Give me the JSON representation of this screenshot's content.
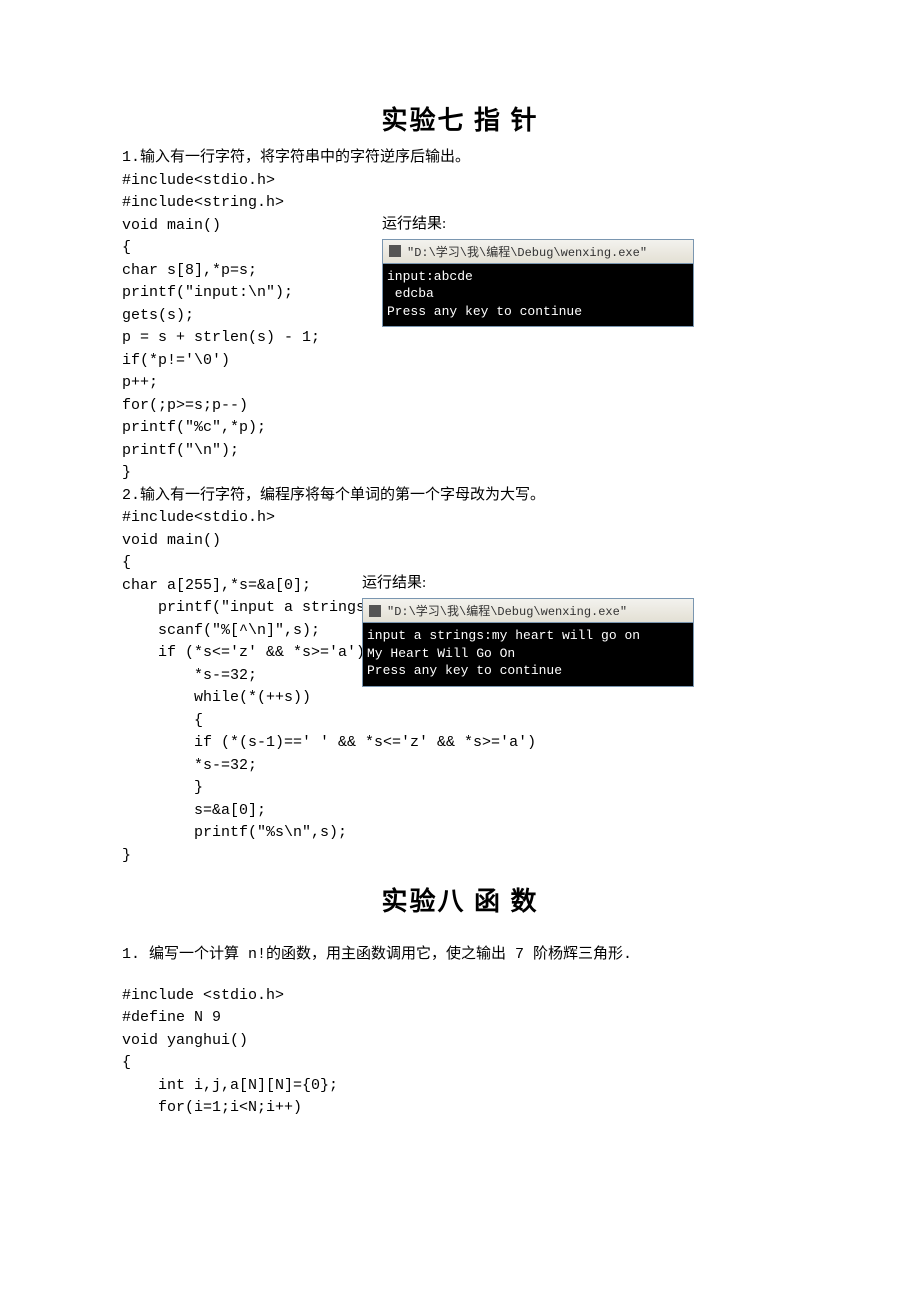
{
  "section7": {
    "title": "实验七  指  针",
    "problem1": {
      "desc": "1.输入有一行字符，将字符串中的字符逆序后输出。",
      "code_a": "#include<stdio.h>\n#include<string.h>\nvoid main()\n{\nchar s[8],*p=s;\nprintf(\"input:\\n\");\ngets(s);\np = s + strlen(s) - 1;\nif(*p!='\\0')\np++;\nfor(;p>=s;p--)\nprintf(\"%c\",*p);\nprintf(\"\\n\");\n}",
      "result_label": "运行结果:",
      "console_title": "\"D:\\学习\\我\\编程\\Debug\\wenxing.exe\"",
      "console_body": "input:abcde\n edcba\nPress any key to continue"
    },
    "problem2": {
      "desc": "2.输入有一行字符，编程序将每个单词的第一个字母改为大写。",
      "code_a": "#include<stdio.h>\nvoid main()\n{\nchar a[255],*s=&a[0];\n    printf(\"input a strings:\");\n    scanf(\"%[^\\n]\",s);\n    if (*s<='z' && *s>='a')\n        *s-=32;\n        while(*(++s))\n        {\n        if (*(s-1)==' ' && *s<='z' && *s>='a')\n        *s-=32;\n        }\n        s=&a[0];\n        printf(\"%s\\n\",s);\n}",
      "result_label": "运行结果:",
      "console_title": "\"D:\\学习\\我\\编程\\Debug\\wenxing.exe\"",
      "console_body": "input a strings:my heart will go on\nMy Heart Will Go On\nPress any key to continue"
    }
  },
  "section8": {
    "title": "实验八  函  数",
    "problem1": {
      "desc": "1. 编写一个计算 n!的函数，用主函数调用它，使之输出 7 阶杨辉三角形.",
      "code_a": "#include <stdio.h>\n#define N 9\nvoid yanghui()\n{\n    int i,j,a[N][N]={0};\n    for(i=1;i<N;i++)"
    }
  }
}
